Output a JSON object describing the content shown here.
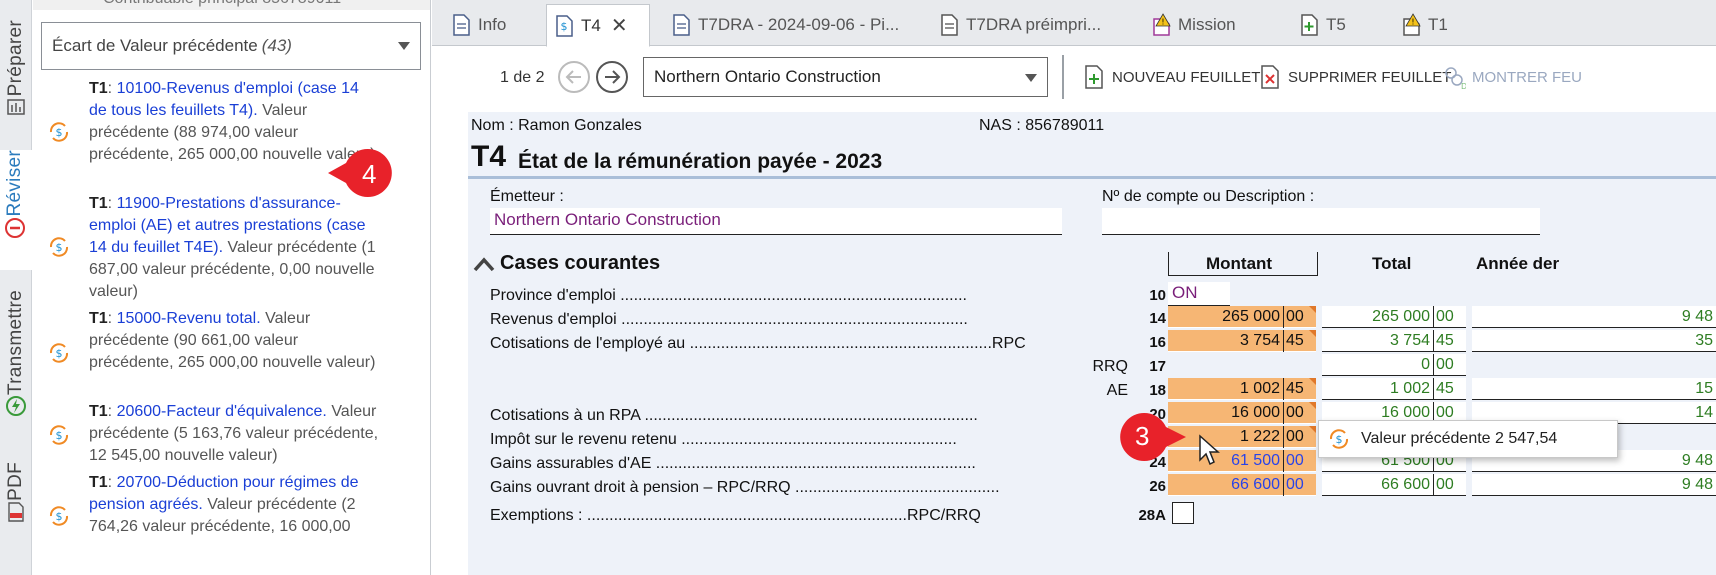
{
  "vtabs": [
    {
      "label": "Préparer",
      "icon": "prepare-icon"
    },
    {
      "label": "Réviser",
      "icon": "review-icon"
    },
    {
      "label": "Transmettre",
      "icon": "transmit-icon"
    },
    {
      "label": "PDF",
      "icon": "pdf-icon"
    }
  ],
  "review": {
    "top_cut_text": "Contribuable principal 856789011",
    "filter": {
      "label": "Écart de Valeur précédente",
      "count": "(43)"
    },
    "items": [
      {
        "form": "T1",
        "sep": ": ",
        "link": "10100-Revenus d'emploi (case 14 de tous les feuillets T4).",
        "desc": " Valeur précédente (88 974,00 valeur précédente, 265 000,00 nouvelle valeur)"
      },
      {
        "form": "T1",
        "sep": ": ",
        "link": "11900-Prestations d'assurance-emploi (AE) et autres prestations (case 14 du feuillet T4E).",
        "desc": " Valeur précédente (1 687,00 valeur précédente, 0,00 nouvelle valeur)"
      },
      {
        "form": "T1",
        "sep": ": ",
        "link": "15000-Revenu total.",
        "desc": " Valeur précédente (90 661,00 valeur précédente, 265 000,00 nouvelle valeur)"
      },
      {
        "form": "T1",
        "sep": ": ",
        "link": "20600-Facteur d'équivalence.",
        "desc": " Valeur précédente (5 163,76 valeur précédente, 12 545,00 nouvelle valeur)"
      },
      {
        "form": "T1",
        "sep": ": ",
        "link": "20700-Déduction pour régimes de pension agréés.",
        "desc": " Valeur précédente (2 764,26 valeur précédente, 16 000,00"
      }
    ]
  },
  "badges": {
    "b4": "4",
    "b3": "3"
  },
  "tabs": [
    {
      "label": "Info"
    },
    {
      "label": "T4",
      "close": "✕"
    },
    {
      "label": "T7DRA - 2024-09-06 - Pi..."
    },
    {
      "label": "T7DRA préimpri..."
    },
    {
      "label": "Mission"
    },
    {
      "label": "T5"
    },
    {
      "label": "T1"
    }
  ],
  "toolbar": {
    "pager": "1 de 2",
    "sheet": "Northern Ontario Construction",
    "new_sheet": "NOUVEAU FEUILLET",
    "delete_sheet": "SUPPRIMER FEUILLET",
    "show_sheet": "MONTRER FEU"
  },
  "form": {
    "name_label": "Nom : Ramon Gonzales",
    "sin_label": "NAS : 856789011",
    "form_code": "T4",
    "form_title": "État de la rémunération payée - 2023",
    "issuer_label": "Émetteur :",
    "issuer_value": "Northern Ontario Construction",
    "account_label": "Nº de compte ou Description :",
    "section": "Cases courantes",
    "col_amount": "Montant",
    "col_total": "Total",
    "col_prev": "Année der",
    "province_value": "ON",
    "rows": [
      {
        "label": "Province d'emploi ..............................................................................",
        "code": "10"
      },
      {
        "label": "Revenus d'emploi ..............................................................................",
        "code": "14"
      },
      {
        "label": "Cotisations de l'employé au ....................................................................RPC",
        "code": "16"
      },
      {
        "label": "",
        "sub": "RRQ",
        "code": "17"
      },
      {
        "label": "",
        "sub": "AE",
        "code": "18"
      },
      {
        "label": "Cotisations à un RPA ...........................................................................",
        "code": "20"
      },
      {
        "label": "Impôt sur le revenu retenu ..............................................................",
        "code": "22"
      },
      {
        "label": "Gains assurables d'AE ........................................................................",
        "code": "24"
      },
      {
        "label": "Gains ouvrant droit à pension – RPC/RRQ ..............................................",
        "code": "26"
      },
      {
        "label": "Exemptions : ........................................................................RPC/RRQ",
        "code": "28A"
      }
    ],
    "amounts": [
      {
        "d": "265 000",
        "c": "00"
      },
      {
        "d": "3 754",
        "c": "45"
      },
      {
        "d": "1 002",
        "c": "45"
      },
      {
        "d": "16 000",
        "c": "00"
      },
      {
        "d": "1 222",
        "c": "00"
      },
      {
        "d": "61 500",
        "c": "00"
      },
      {
        "d": "66 600",
        "c": "00"
      }
    ],
    "totals": [
      {
        "d": "265 000",
        "c": "00"
      },
      {
        "d": "3 754",
        "c": "45"
      },
      {
        "d": "0",
        "c": "00"
      },
      {
        "d": "1 002",
        "c": "45"
      },
      {
        "d": "16 000",
        "c": "00"
      },
      {
        "d": "61 500",
        "c": "00"
      },
      {
        "d": "66 600",
        "c": "00"
      }
    ],
    "prev": [
      "9 48",
      "35",
      "15",
      "14",
      "9 48",
      "9 48"
    ],
    "tooltip": "Valeur précédente 2 547,54"
  }
}
